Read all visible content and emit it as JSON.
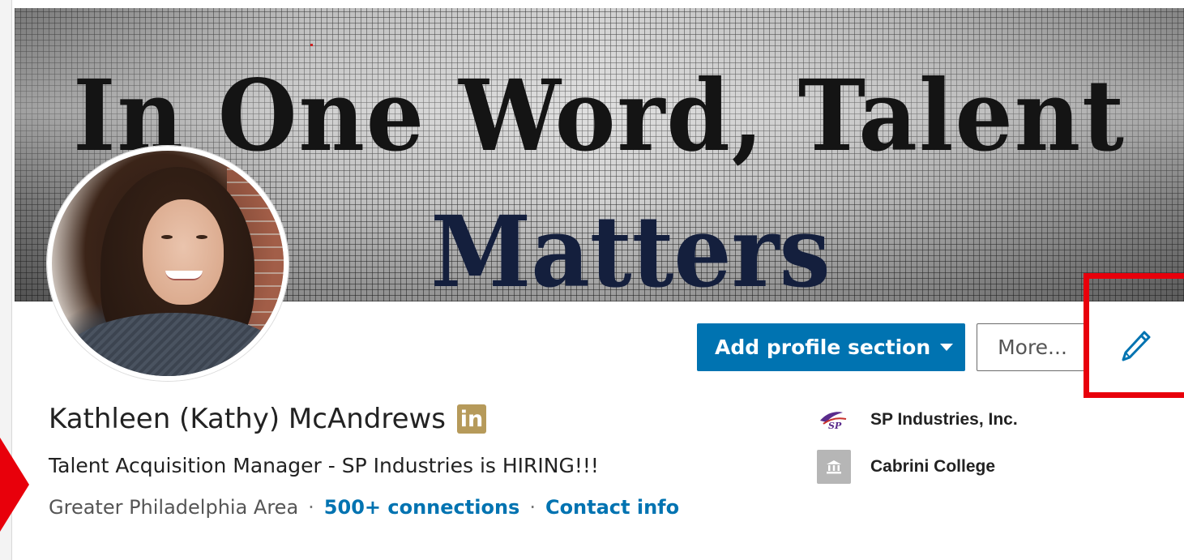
{
  "banner": {
    "line1": "In One Word, Talent",
    "line2": "Matters"
  },
  "actions": {
    "add_section_label": "Add profile section",
    "more_label": "More..."
  },
  "profile": {
    "name": "Kathleen (Kathy) McAndrews",
    "badge": "in",
    "headline": "Talent Acquisition Manager - SP Industries is HIRING!!!",
    "location": "Greater Philadelphia Area",
    "separator": "·",
    "connections": "500+ connections",
    "contact": "Contact info"
  },
  "orgs": [
    {
      "name": "SP Industries, Inc.",
      "logo_text": "SP",
      "icon": "sp-logo-icon"
    },
    {
      "name": "Cabrini College",
      "icon": "school-icon"
    }
  ],
  "icons": {
    "edit": "pencil-icon",
    "caret": "caret-down-icon"
  },
  "colors": {
    "primary": "#0073b1",
    "highlight": "#e8000b",
    "badge": "#b69a5a"
  }
}
